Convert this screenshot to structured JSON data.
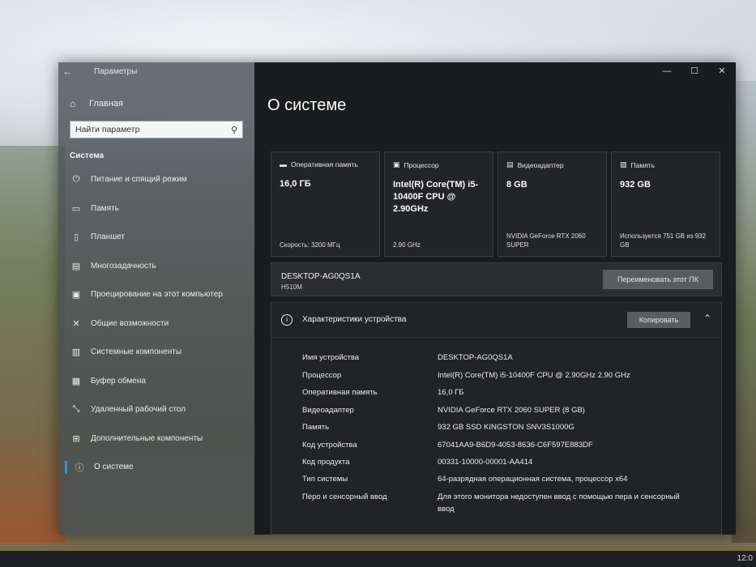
{
  "window": {
    "title": "Параметры"
  },
  "sidebar": {
    "home_label": "Главная",
    "search_placeholder": "Найти параметр",
    "section": "Система",
    "items": [
      {
        "label": "Питание и спящий режим",
        "icon": "power-icon"
      },
      {
        "label": "Память",
        "icon": "storage-icon"
      },
      {
        "label": "Планшет",
        "icon": "tablet-icon"
      },
      {
        "label": "Многозадачность",
        "icon": "multitasking-icon"
      },
      {
        "label": "Проецирование на этот компьютер",
        "icon": "projecting-icon"
      },
      {
        "label": "Общие возможности",
        "icon": "shared-experiences-icon"
      },
      {
        "label": "Системные компоненты",
        "icon": "system-components-icon"
      },
      {
        "label": "Буфер обмена",
        "icon": "clipboard-icon"
      },
      {
        "label": "Удаленный рабочий стол",
        "icon": "remote-desktop-icon"
      },
      {
        "label": "Дополнительные компоненты",
        "icon": "optional-features-icon"
      },
      {
        "label": "О системе",
        "icon": "info-icon",
        "active": true
      }
    ]
  },
  "main": {
    "title": "О системе",
    "cards": {
      "ram": {
        "label": "Оперативная память",
        "value": "16,0 ГБ",
        "foot": "Скорость: 3200 МГц"
      },
      "cpu": {
        "label": "Процессор",
        "value": "Intel(R) Core(TM) i5-10400F CPU @ 2.90GHz",
        "foot": "2.90 GHz"
      },
      "gpu": {
        "label": "Видеоадаптер",
        "value": "8 GB",
        "foot": "NVIDIA GeForce RTX 2060 SUPER"
      },
      "storage": {
        "label": "Память",
        "value": "932 GB",
        "foot": "Используется 751 GB из 932 GB"
      }
    },
    "device": {
      "name": "DESKTOP-AG0QS1A",
      "model": "H510M",
      "rename_button": "Переименовать этот ПК"
    },
    "specs": {
      "title": "Характеристики устройства",
      "copy_button": "Копировать",
      "rows": [
        {
          "label": "Имя устройства",
          "value": "DESKTOP-AG0QS1A"
        },
        {
          "label": "Процессор",
          "value": "Intel(R) Core(TM) i5-10400F CPU @ 2.90GHz   2.90 GHz"
        },
        {
          "label": "Оперативная память",
          "value": "16,0 ГБ"
        },
        {
          "label": "Видеоадаптер",
          "value": "NVIDIA GeForce RTX 2060 SUPER (8 GB)"
        },
        {
          "label": "Память",
          "value": "932 GB SSD KINGSTON SNV3S1000G"
        },
        {
          "label": "Код устройства",
          "value": "67041AA9-B6D9-4053-8636-C6F597E883DF"
        },
        {
          "label": "Код продукта",
          "value": "00331-10000-00001-AA414"
        },
        {
          "label": "Тип системы",
          "value": "64-разрядная операционная система, процессор x64"
        },
        {
          "label": "Перо и сенсорный ввод",
          "value": "Для этого монитора недоступен ввод с помощью пера и сенсорный ввод"
        }
      ]
    }
  },
  "taskbar": {
    "clock": "12:0"
  }
}
